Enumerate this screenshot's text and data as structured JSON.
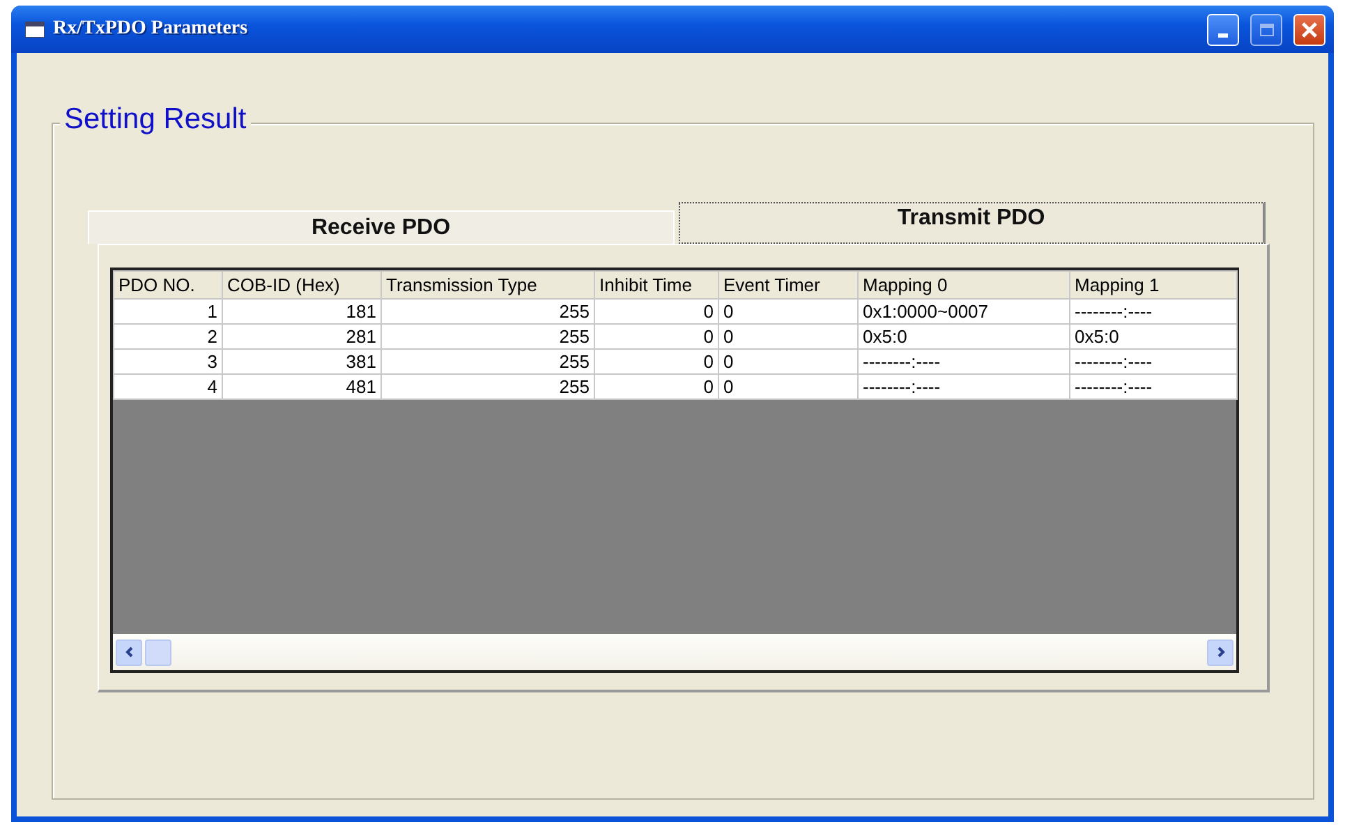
{
  "window": {
    "title": "Rx/TxPDO Parameters"
  },
  "group": {
    "title": "Setting Result"
  },
  "tabs": [
    {
      "label": "Receive PDO",
      "selected": false
    },
    {
      "label": "Transmit PDO",
      "selected": true
    }
  ],
  "table": {
    "columns": [
      "PDO NO.",
      "COB-ID (Hex)",
      "Transmission Type",
      "Inhibit Time",
      "Event Timer",
      "Mapping 0",
      "Mapping 1"
    ],
    "rows": [
      [
        "1",
        "181",
        "255",
        "0",
        "0",
        "0x1:0000~0007",
        "--------:----"
      ],
      [
        "2",
        "281",
        "255",
        "0",
        "0",
        "0x5:0",
        "0x5:0"
      ],
      [
        "3",
        "381",
        "255",
        "0",
        "0",
        "--------:----",
        "--------:----"
      ],
      [
        "4",
        "481",
        "255",
        "0",
        "0",
        "--------:----",
        "--------:----"
      ]
    ]
  }
}
